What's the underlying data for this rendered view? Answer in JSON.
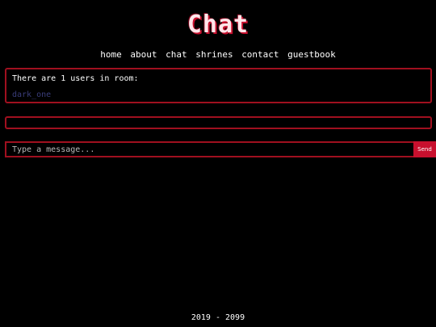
{
  "header": {
    "title": "Chat"
  },
  "nav": {
    "items": [
      {
        "label": "home"
      },
      {
        "label": "about"
      },
      {
        "label": "chat"
      },
      {
        "label": "shrines"
      },
      {
        "label": "contact"
      },
      {
        "label": "guestbook"
      }
    ]
  },
  "users_panel": {
    "heading": "There are 1 users in room:",
    "users": [
      "dark_one"
    ]
  },
  "composer": {
    "placeholder": "Type a message...",
    "send_label": "Send"
  },
  "footer": {
    "text": "2019 - 2099"
  },
  "colors": {
    "background": "#000000",
    "accent": "#c8102e",
    "border": "#a0101f",
    "username": "#3a3d7a"
  }
}
